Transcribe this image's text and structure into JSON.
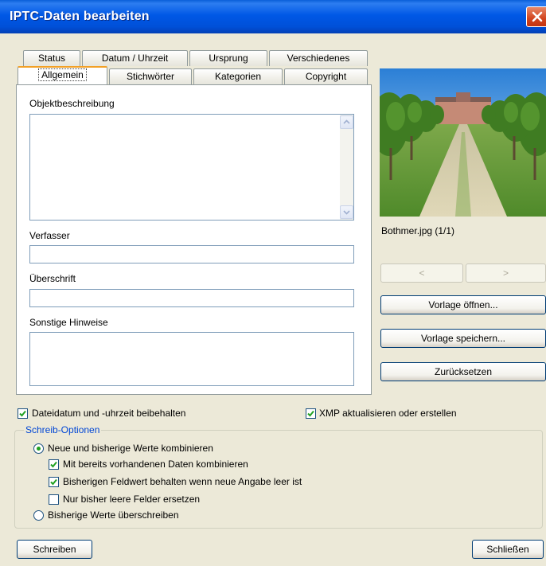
{
  "window": {
    "title": "IPTC-Daten bearbeiten",
    "close_label": "close"
  },
  "tabs": {
    "row1": [
      "Status",
      "Datum / Uhrzeit",
      "Ursprung",
      "Verschiedenes"
    ],
    "row2": [
      "Allgemein",
      "Stichwörter",
      "Kategorien",
      "Copyright"
    ]
  },
  "form": {
    "objektbeschreibung_label": "Objektbeschreibung",
    "objektbeschreibung_value": "",
    "verfasser_label": "Verfasser",
    "verfasser_value": "",
    "ueberschrift_label": "Überschrift",
    "ueberschrift_value": "",
    "hinweise_label": "Sonstige Hinweise",
    "hinweise_value": ""
  },
  "preview": {
    "filename": "Bothmer.jpg (1/1)",
    "prev_label": "<",
    "next_label": ">"
  },
  "buttons": {
    "vorlage_oeffnen": "Vorlage öffnen...",
    "vorlage_speichern": "Vorlage speichern...",
    "zuruecksetzen": "Zurücksetzen",
    "schreiben": "Schreiben",
    "schliessen": "Schließen"
  },
  "options": {
    "dateidatum": {
      "label": "Dateidatum und -uhrzeit beibehalten",
      "checked": true
    },
    "xmp": {
      "label": "XMP aktualisieren oder erstellen",
      "checked": true
    },
    "group_title": "Schreib-Optionen",
    "radio_combine": {
      "label": "Neue und bisherige Werte kombinieren",
      "selected": true
    },
    "chk_mit_bereits": {
      "label": "Mit bereits vorhandenen Daten kombinieren",
      "checked": true
    },
    "chk_bisherigen": {
      "label": "Bisherigen Feldwert behalten wenn neue Angabe leer ist",
      "checked": true
    },
    "chk_nur_leere": {
      "label": "Nur bisher leere Felder ersetzen",
      "checked": false
    },
    "radio_overwrite": {
      "label": "Bisherige Werte überschreiben",
      "selected": false
    }
  }
}
